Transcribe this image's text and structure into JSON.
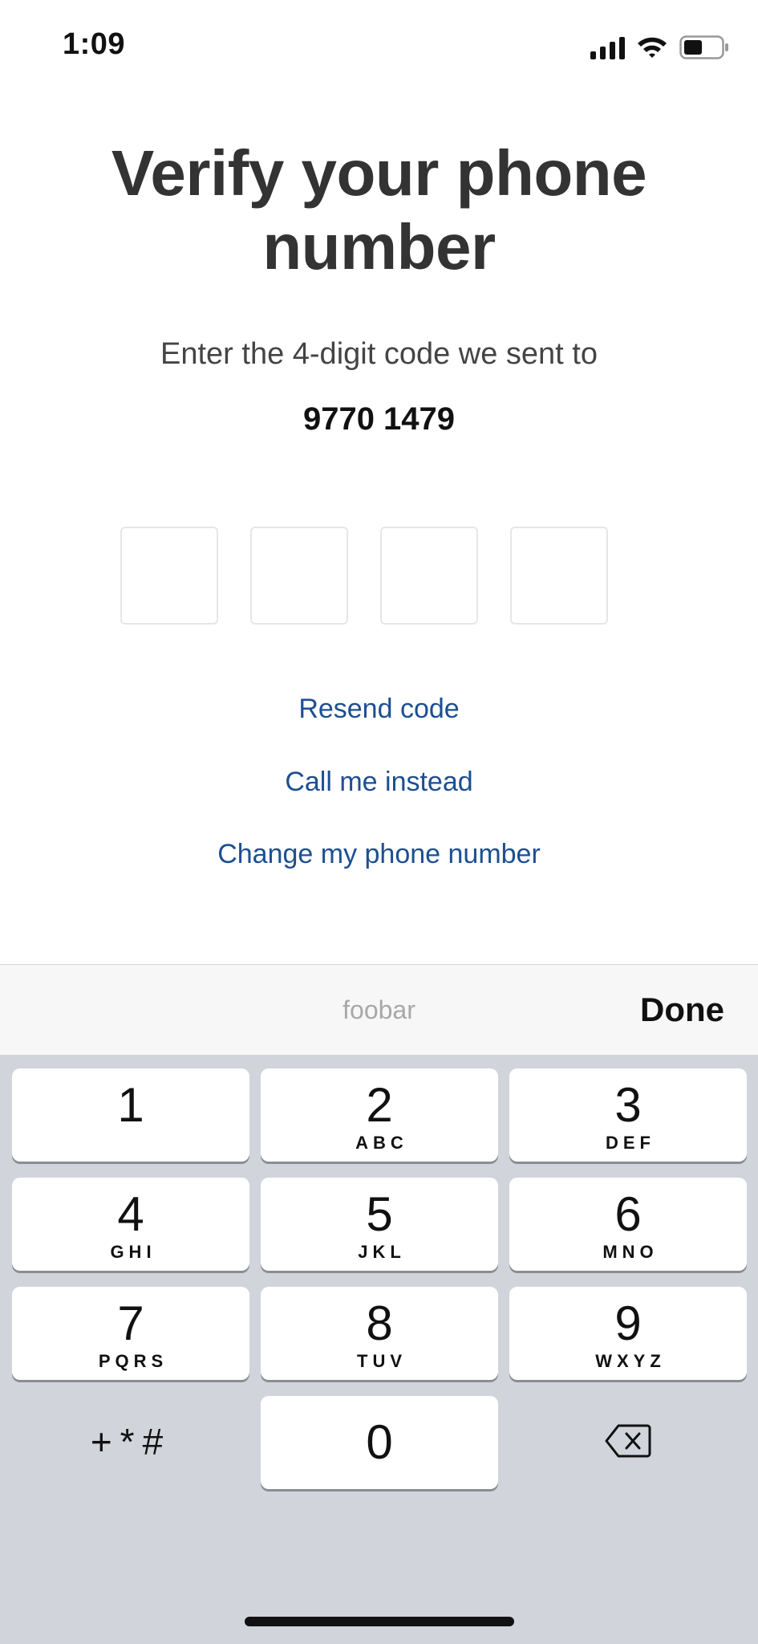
{
  "status_bar": {
    "time": "1:09"
  },
  "header": {
    "title_line1": "Verify your phone",
    "title_line2": "number",
    "subtitle": "Enter the 4-digit code we sent to",
    "phone_number": "9770 1479"
  },
  "code_inputs": {
    "count": 4
  },
  "links": {
    "resend": "Resend code",
    "call": "Call me instead",
    "change": "Change my phone number"
  },
  "accessory_bar": {
    "label": "foobar",
    "done": "Done"
  },
  "keypad": {
    "keys": [
      {
        "num": "1",
        "letters": ""
      },
      {
        "num": "2",
        "letters": "ABC"
      },
      {
        "num": "3",
        "letters": "DEF"
      },
      {
        "num": "4",
        "letters": "GHI"
      },
      {
        "num": "5",
        "letters": "JKL"
      },
      {
        "num": "6",
        "letters": "MNO"
      },
      {
        "num": "7",
        "letters": "PQRS"
      },
      {
        "num": "8",
        "letters": "TUV"
      },
      {
        "num": "9",
        "letters": "WXYZ"
      }
    ],
    "symbols": "+*#",
    "zero": "0"
  },
  "colors": {
    "link": "#1d4f91",
    "keypad_bg": "#d1d4da",
    "title": "#333333"
  },
  "icons": [
    "signal-icon",
    "wifi-icon",
    "battery-icon",
    "backspace-icon"
  ]
}
